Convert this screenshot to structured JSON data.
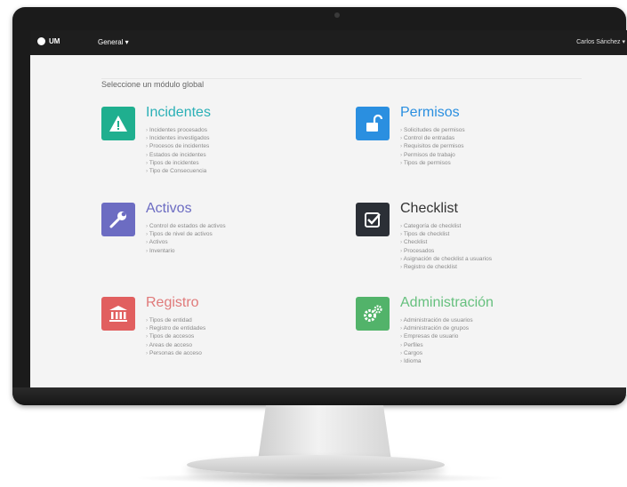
{
  "navbar": {
    "brand": "UM",
    "general_menu": "General ▾",
    "user_menu": "Carlos Sánchez ▾"
  },
  "breadcrumb": "",
  "subtitle": "Seleccione un módulo global",
  "modules": [
    {
      "title": "Incidentes",
      "icon": "warning-icon",
      "color": "#1faf8f",
      "items": [
        "Incidentes procesados",
        "Incidentes investigados",
        "Procesos de incidentes",
        "Estados de incidentes",
        "Tipos de incidentes",
        "Tipo de Consecuencia"
      ]
    },
    {
      "title": "Permisos",
      "icon": "unlock-icon",
      "color": "#2a8fe0",
      "items": [
        "Solicitudes de permisos",
        "Control de entradas",
        "Requisitos de permisos",
        "Permisos de trabajo",
        "Tipos de permisos"
      ]
    },
    {
      "title": "Activos",
      "icon": "wrench-icon",
      "color": "#6c6cc2",
      "items": [
        "Control de estados de activos",
        "Tipos de nivel de activos",
        "Activos",
        "Inventario"
      ]
    },
    {
      "title": "Checklist",
      "icon": "checkbox-icon",
      "color": "#2b2f36",
      "items": [
        "Categoría de checklist",
        "Tipos de checklist",
        "Checklist",
        "Procesados",
        "Asignación de checklist a usuarios",
        "Registro de checklist"
      ]
    },
    {
      "title": "Registro",
      "icon": "bank-icon",
      "color": "#e15f5f",
      "items": [
        "Tipos de entidad",
        "Registro de entidades",
        "Tipos de accesos",
        "Areas de acceso",
        "Personas de acceso"
      ]
    },
    {
      "title": "Administración",
      "icon": "gears-icon",
      "color": "#52b36a",
      "items": [
        "Administración de usuarios",
        "Administración de grupos",
        "Empresas de usuario",
        "Perfiles",
        "Cargos",
        "Idioma"
      ]
    }
  ]
}
